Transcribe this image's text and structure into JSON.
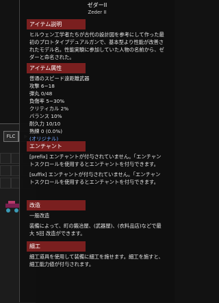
{
  "background_window": {
    "tabs": [
      "FLC",
      "▶"
    ]
  },
  "tooltip": {
    "title": "ゼダーII",
    "subtitle": "Zeder II",
    "sections": {
      "description": {
        "header": "アイテム説明",
        "text": "ヒルウェン工学者たちが古代の設計図を参考にして作った最初のプロトタイプデュアルガンで、基本型より性能が改善されたモデル名。性能実験に参加していた人物の名前から、ゼダーと命名された。"
      },
      "attributes": {
        "header": "アイテム属性",
        "rows": [
          "普通のスピード遠距離武器",
          "攻撃 6~18",
          "弾丸 0/48",
          "負傷率 5~30%",
          "クリティカル 2%",
          "バランス 10%",
          "耐久力 10/10",
          "熟練 0 (0.0%)",
          "(オリジナル)"
        ]
      },
      "enchant": {
        "header": "エンチャント",
        "prefix": "[prefix] エンチャントが付与されていません。「エンチャントスクロールを使用するとエンチャントを付与できます。",
        "suffix": "[suffix] エンチャントが付与されていません。「エンチャントスクロールを使用するとエンチャントを付与できます。"
      },
      "upgrade": {
        "header": "改造",
        "subheader": "一般改造",
        "text": "装備によって、町の鍛冶屋、(武器屋)、(衣料品店)などで最大 5回 改造ができます。"
      },
      "craft": {
        "header": "細工",
        "text": "細工道具を使用して装備に細工を施せます。細工を施すと、細工能力値が付与されます。"
      }
    }
  },
  "colors": {
    "section_header_bg": "#7a1f1f",
    "original_tag": "#79a7ff"
  }
}
